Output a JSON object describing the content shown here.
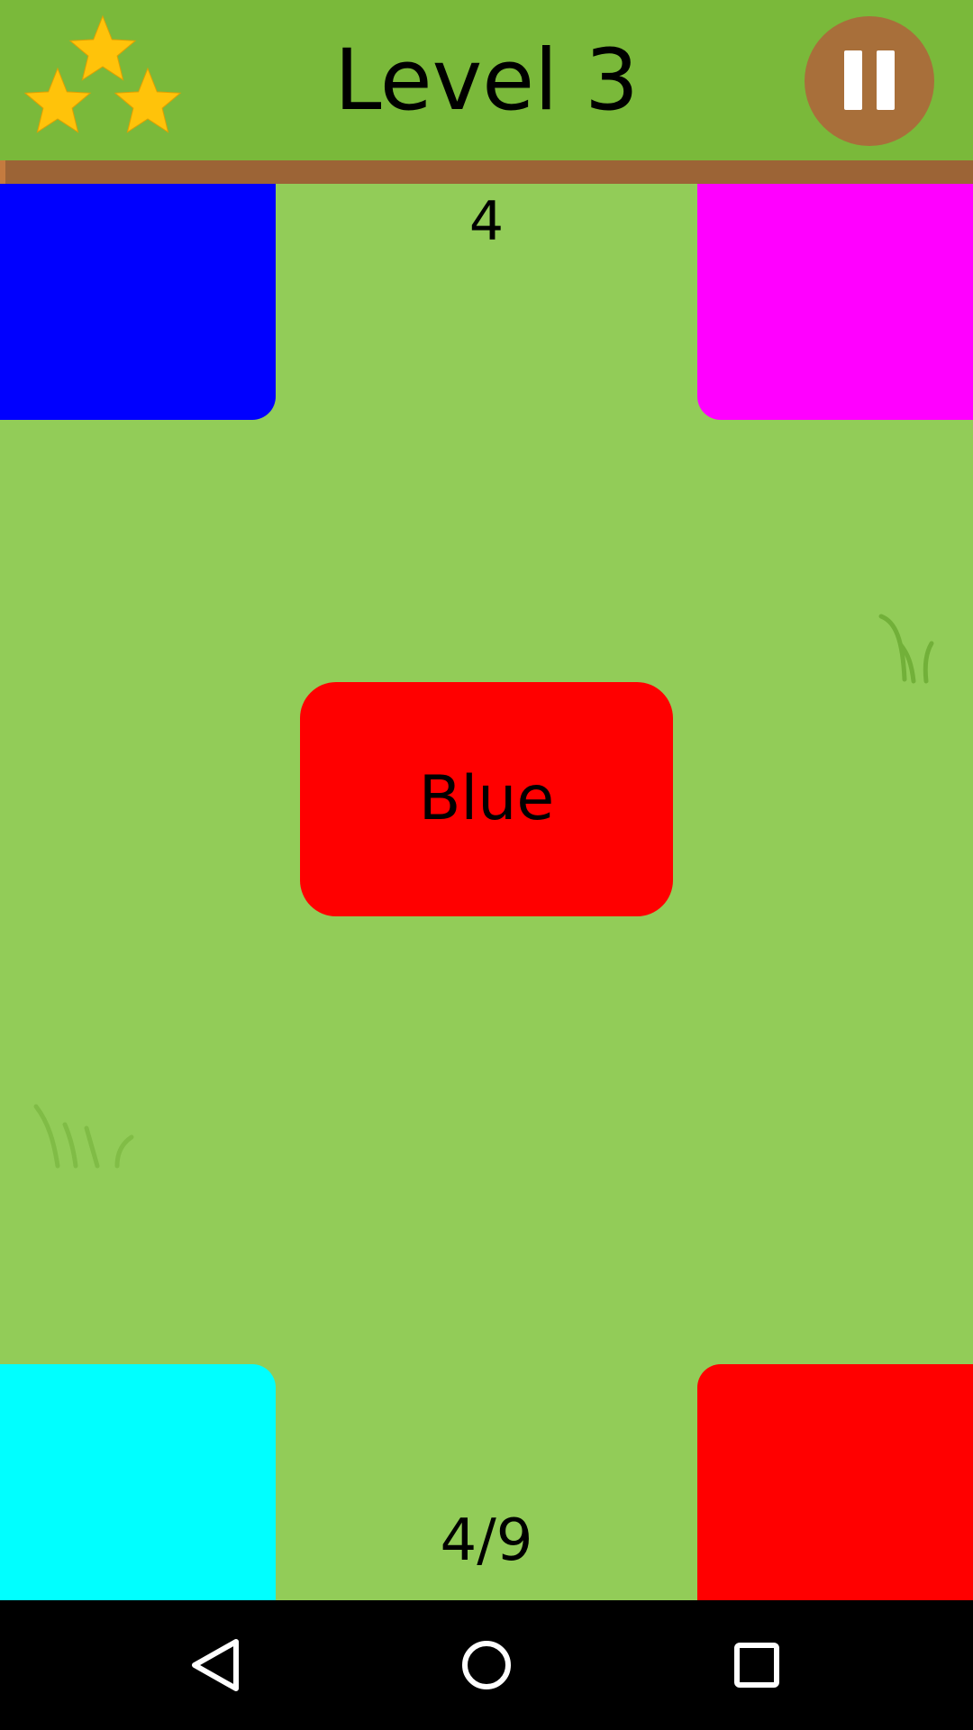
{
  "header": {
    "title": "Level 3",
    "stars_earned": 3,
    "stars_total": 3,
    "star_icon": "star-icon",
    "pause_icon": "pause-icon"
  },
  "game": {
    "counter": "4",
    "progress": "4/9",
    "word_card": {
      "label": "Blue",
      "color": "#ff0000"
    },
    "tiles": [
      {
        "position": "top-left",
        "color": "#0000ff"
      },
      {
        "position": "top-right",
        "color": "#ff00ff"
      },
      {
        "position": "bottom-left",
        "color": "#00ffff"
      },
      {
        "position": "bottom-right",
        "color": "#ff0000"
      }
    ]
  },
  "navbar": {
    "back_icon": "back-triangle-icon",
    "home_icon": "home-circle-icon",
    "recents_icon": "recents-square-icon"
  },
  "colors": {
    "header_bg": "#7ab93a",
    "field_bg": "#92cc58",
    "dirt": "#9c6436",
    "pause_bg": "#a86f3a",
    "star": "#ffc30a"
  }
}
